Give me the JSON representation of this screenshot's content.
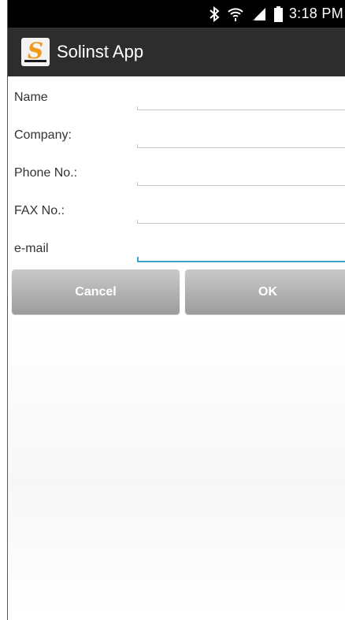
{
  "status_bar": {
    "icons": [
      "bluetooth-icon",
      "wifi-icon",
      "signal-icon",
      "battery-icon"
    ],
    "time": "3:18 PM"
  },
  "action_bar": {
    "logo_letter": "S",
    "title": "Solinst App",
    "logo_color": "#f09a1b"
  },
  "form": {
    "fields": [
      {
        "label": "Name",
        "value": "",
        "focused": false
      },
      {
        "label": "Company:",
        "value": "",
        "focused": false
      },
      {
        "label": "Phone No.:",
        "value": "",
        "focused": false
      },
      {
        "label": "FAX No.:",
        "value": "",
        "focused": false
      },
      {
        "label": "e-mail",
        "value": "",
        "focused": true
      }
    ],
    "focus_color": "#3aa5c8"
  },
  "buttons": {
    "cancel_label": "Cancel",
    "ok_label": "OK"
  }
}
